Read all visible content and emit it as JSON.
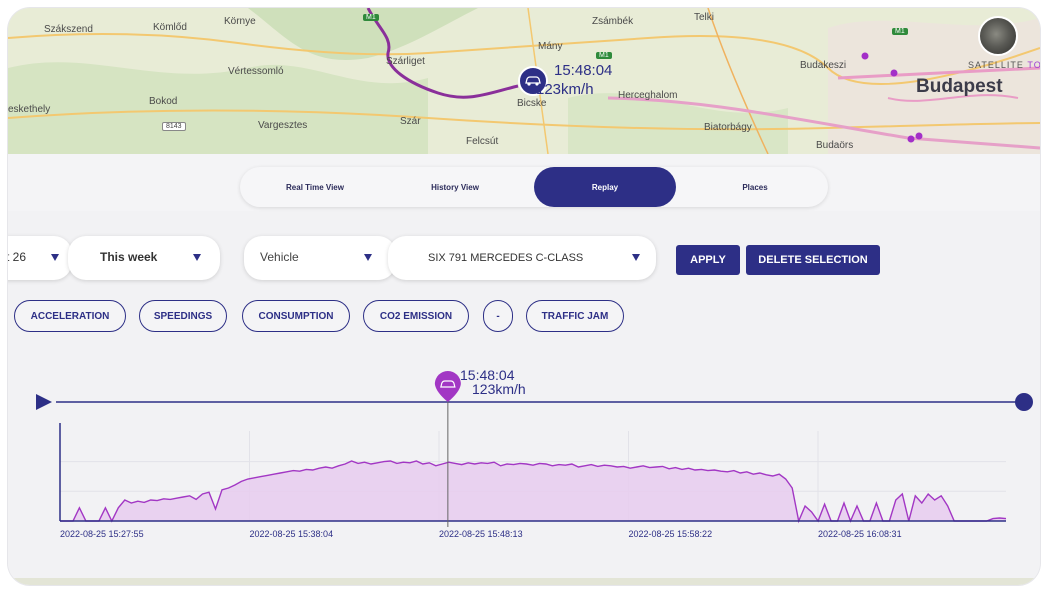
{
  "map": {
    "places": [
      "Szákszend",
      "Kömlőd",
      "Környe",
      "Zsámbék",
      "Telki",
      "Mány",
      "Vértessomló",
      "Szárliget",
      "Budakeszi",
      "Budapest",
      "Bokod",
      "eskethely",
      "Herceghalom",
      "Bicske",
      "Vargesztes",
      "Szár",
      "Felcsút",
      "Biatorbágy",
      "Budaörs"
    ],
    "roads": [
      "M1",
      "M1",
      "8143",
      "M1"
    ],
    "marker_time": "15:48:04",
    "marker_speed": "123km/h",
    "layer_toggle": "SATELLITE",
    "layer_toggle_2": "TO"
  },
  "tabs": [
    {
      "label": "Real Time View",
      "active": false
    },
    {
      "label": "History View",
      "active": false
    },
    {
      "label": "Replay",
      "active": true
    },
    {
      "label": "Places",
      "active": false
    }
  ],
  "filters": {
    "date_partial": "t 26",
    "period": "This week",
    "type_placeholder": "Vehicle",
    "vehicle": "SIX 791  MERCEDES C-CLASS",
    "apply_label": "APPLY",
    "delete_label": "DELETE SELECTION"
  },
  "chips": [
    "ACCELERATION",
    "SPEEDINGS",
    "CONSUMPTION",
    "CO2 EMISSION",
    "-",
    "TRAFFIC JAM"
  ],
  "timeline": {
    "cursor_time": "15:48:04",
    "cursor_speed": "123km/h",
    "cursor_fraction": 0.41
  },
  "chart_data": {
    "type": "area",
    "x_ticks": [
      "2022-08-25 15:27:55",
      "2022-08-25 15:38:04",
      "2022-08-25 15:48:13",
      "2022-08-25 15:58:22",
      "2022-08-25 16:08:31"
    ],
    "y_range": [
      0,
      150
    ],
    "series": [
      {
        "values": [
          0,
          0,
          0,
          22,
          0,
          0,
          0,
          22,
          0,
          22,
          35,
          30,
          33,
          31,
          35,
          34,
          37,
          36,
          38,
          40,
          42,
          36,
          45,
          48,
          20,
          52,
          55,
          60,
          66,
          70,
          72,
          74,
          76,
          78,
          80,
          82,
          84,
          83,
          86,
          85,
          88,
          90,
          88,
          92,
          95,
          100,
          96,
          98,
          95,
          97,
          99,
          100,
          96,
          98,
          97,
          100,
          95,
          97,
          92,
          95,
          98,
          96,
          94,
          97,
          95,
          97,
          96,
          98,
          92,
          95,
          94,
          96,
          95,
          93,
          96,
          95,
          92,
          94,
          93,
          95,
          90,
          92,
          94,
          91,
          93,
          92,
          90,
          91,
          88,
          90,
          92,
          89,
          90,
          91,
          87,
          89,
          86,
          88,
          85,
          86,
          84,
          85,
          83,
          82,
          84,
          80,
          82,
          78,
          80,
          77,
          75,
          78,
          70,
          55,
          0,
          25,
          15,
          0,
          28,
          0,
          0,
          30,
          0,
          25,
          0,
          0,
          30,
          0,
          0,
          35,
          45,
          0,
          42,
          30,
          45,
          35,
          42,
          25,
          0,
          0,
          0,
          0,
          0,
          0,
          4,
          5,
          4
        ]
      }
    ]
  },
  "colors": {
    "primary": "#2d2f86",
    "series_line": "#a237c4",
    "series_fill": "#e8cdee",
    "marker": "#a237c4"
  }
}
